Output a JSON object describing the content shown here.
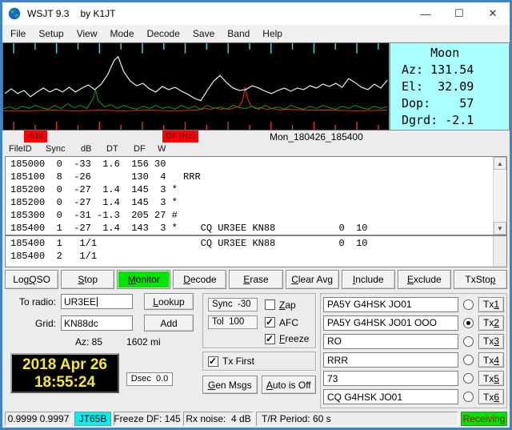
{
  "window": {
    "title_app": "WSJT 9.3",
    "title_by": "by K1JT",
    "minimize_glyph": "—",
    "maximize_glyph": "☐",
    "close_glyph": "✕"
  },
  "menu": {
    "items": [
      "File",
      "Setup",
      "View",
      "Mode",
      "Decode",
      "Save",
      "Band",
      "Help"
    ]
  },
  "moon": {
    "lines": [
      "    Moon",
      "Az: 131.54",
      "El:  32.09",
      "Dop:    57",
      "Dgrd: -2.1"
    ]
  },
  "spectrum": {
    "left_chip": "-516",
    "df_chip": "DF (Hz)",
    "file_stamp": "Mon_180426_185400",
    "ticks": {
      "count": 18,
      "start": 13,
      "spacing": 26.7,
      "top_color": "#3adada",
      "bottom_color": "#e83030",
      "top_tall": 13,
      "top_short": 8,
      "bottom_tall": 10,
      "bottom_short": 6
    },
    "cyan_trace": [
      [
        2,
        64
      ],
      [
        10,
        58
      ],
      [
        18,
        64
      ],
      [
        26,
        60
      ],
      [
        34,
        68
      ],
      [
        42,
        62
      ],
      [
        50,
        57
      ],
      [
        58,
        62
      ],
      [
        66,
        58
      ],
      [
        74,
        62
      ],
      [
        82,
        56
      ],
      [
        90,
        62
      ],
      [
        98,
        57
      ],
      [
        106,
        53
      ],
      [
        114,
        59
      ],
      [
        122,
        52
      ],
      [
        130,
        40
      ],
      [
        138,
        22
      ],
      [
        143,
        17
      ],
      [
        150,
        36
      ],
      [
        158,
        48
      ],
      [
        166,
        54
      ],
      [
        174,
        51
      ],
      [
        182,
        58
      ],
      [
        190,
        62
      ],
      [
        198,
        55
      ],
      [
        206,
        59
      ],
      [
        214,
        56
      ],
      [
        222,
        61
      ],
      [
        230,
        65
      ],
      [
        238,
        70
      ],
      [
        246,
        73
      ],
      [
        254,
        60
      ],
      [
        262,
        48
      ],
      [
        270,
        41
      ],
      [
        278,
        50
      ],
      [
        286,
        57
      ],
      [
        294,
        60
      ],
      [
        302,
        59
      ],
      [
        310,
        54
      ],
      [
        318,
        57
      ],
      [
        326,
        61
      ],
      [
        334,
        64
      ],
      [
        342,
        60
      ],
      [
        350,
        57
      ],
      [
        358,
        61
      ],
      [
        366,
        57
      ],
      [
        374,
        59
      ],
      [
        382,
        54
      ],
      [
        390,
        57
      ],
      [
        398,
        52
      ],
      [
        406,
        55
      ],
      [
        414,
        51
      ],
      [
        422,
        56
      ],
      [
        430,
        45
      ],
      [
        438,
        50
      ],
      [
        446,
        56
      ],
      [
        454,
        59
      ],
      [
        462,
        52
      ],
      [
        470,
        57
      ],
      [
        478,
        47
      ]
    ],
    "green_trace": [
      [
        0,
        83
      ],
      [
        8,
        81
      ],
      [
        16,
        84
      ],
      [
        24,
        80
      ],
      [
        32,
        83
      ],
      [
        40,
        79
      ],
      [
        48,
        82
      ],
      [
        56,
        84
      ],
      [
        64,
        79
      ],
      [
        72,
        83
      ],
      [
        80,
        77
      ],
      [
        88,
        82
      ],
      [
        96,
        79
      ],
      [
        104,
        83
      ],
      [
        112,
        70
      ],
      [
        115,
        59
      ],
      [
        118,
        73
      ],
      [
        126,
        81
      ],
      [
        134,
        78
      ],
      [
        142,
        83
      ],
      [
        150,
        79
      ],
      [
        158,
        82
      ],
      [
        166,
        84
      ],
      [
        174,
        80
      ],
      [
        182,
        83
      ],
      [
        190,
        79
      ],
      [
        198,
        83
      ],
      [
        206,
        81
      ],
      [
        214,
        84
      ],
      [
        222,
        79
      ],
      [
        230,
        83
      ],
      [
        238,
        80
      ],
      [
        246,
        84
      ],
      [
        254,
        79
      ],
      [
        262,
        83
      ],
      [
        270,
        81
      ],
      [
        278,
        84
      ],
      [
        286,
        79
      ],
      [
        294,
        82
      ],
      [
        302,
        83
      ],
      [
        310,
        80
      ],
      [
        318,
        84
      ],
      [
        326,
        79
      ],
      [
        334,
        83
      ],
      [
        342,
        81
      ],
      [
        350,
        84
      ],
      [
        358,
        79
      ],
      [
        366,
        82
      ],
      [
        374,
        84
      ],
      [
        382,
        80
      ],
      [
        390,
        83
      ],
      [
        398,
        79
      ],
      [
        406,
        82
      ],
      [
        414,
        84
      ],
      [
        422,
        80
      ],
      [
        430,
        83
      ],
      [
        438,
        79
      ],
      [
        446,
        82
      ],
      [
        454,
        84
      ],
      [
        462,
        80
      ],
      [
        470,
        83
      ],
      [
        478,
        81
      ]
    ],
    "red_trace": [
      [
        0,
        86
      ],
      [
        30,
        86
      ],
      [
        60,
        85
      ],
      [
        90,
        86
      ],
      [
        120,
        85
      ],
      [
        150,
        86
      ],
      [
        180,
        85
      ],
      [
        210,
        86
      ],
      [
        240,
        85
      ],
      [
        252,
        83
      ],
      [
        258,
        84
      ],
      [
        264,
        82
      ],
      [
        270,
        84
      ],
      [
        276,
        83
      ],
      [
        282,
        84
      ],
      [
        288,
        82
      ],
      [
        294,
        80
      ],
      [
        298,
        73
      ],
      [
        301,
        56
      ],
      [
        304,
        70
      ],
      [
        308,
        79
      ],
      [
        314,
        83
      ],
      [
        320,
        82
      ],
      [
        328,
        84
      ],
      [
        336,
        83
      ],
      [
        344,
        85
      ],
      [
        352,
        84
      ],
      [
        380,
        85
      ],
      [
        410,
        85
      ],
      [
        440,
        86
      ],
      [
        478,
        85
      ]
    ],
    "colors": {
      "cyan_trace": "#d8f6f2",
      "green_trace": "#00a300",
      "red_trace": "#ff2222"
    }
  },
  "decode": {
    "headers": [
      "FileID",
      "Sync",
      "dB",
      "DT",
      "DF",
      "W"
    ],
    "main_lines": [
      "185000  0  -33  1.6  156 30",
      "185100  8  -26       130  4   RRR",
      "185200  0  -27  1.4  145  3 *",
      "185200  0  -27  1.4  145  3 *",
      "185300  0  -31 -1.3  205 27 #",
      "185400  1  -27  1.4  143  3 *    CQ UR3EE KN88           0  10"
    ],
    "avg_lines": [
      "185400  1   1/1                  CQ UR3EE KN88           0  10",
      "185400  2   1/1"
    ],
    "scroll_up_glyph": "▲",
    "scroll_down_glyph": "▼"
  },
  "actions": {
    "log_qso": {
      "label": "Log QSO",
      "u": 4
    },
    "stop": {
      "label": "Stop",
      "u": 0
    },
    "monitor": {
      "label": "Monitor",
      "u": 0,
      "active": true
    },
    "decode": {
      "label": "Decode",
      "u": 0
    },
    "erase": {
      "label": "Erase",
      "u": 0
    },
    "clear_avg": {
      "label": "Clear Avg",
      "u": 0
    },
    "include": {
      "label": "Include",
      "u": 0
    },
    "exclude": {
      "label": "Exclude",
      "u": 0
    },
    "txstop": {
      "label": "TxStop",
      "u": 5
    }
  },
  "station": {
    "to_radio_label": "To radio:",
    "to_radio_value": "UR3EE",
    "lookup": {
      "label": "Lookup",
      "u": 0
    },
    "grid_label": "Grid:",
    "grid_value": "KN88dc",
    "add": {
      "label": "Add"
    },
    "az_text": "Az: 85",
    "distance_text": "1602 mi"
  },
  "clock": {
    "date": "2018 Apr 26",
    "time": "18:55:24",
    "dsec": "Dsec  0.0"
  },
  "params": {
    "sync_text": "Sync  -30",
    "tol_text": "Tol  100",
    "zap": {
      "label": "Zap",
      "u": 0,
      "checked": false
    },
    "afc": {
      "label": "AFC",
      "checked": true
    },
    "freeze": {
      "label": "Freeze",
      "u": 0,
      "checked": true
    },
    "tx_first": {
      "label": "Tx First",
      "checked": true
    },
    "gen_msgs": {
      "label": "Gen Msgs",
      "u": 0
    },
    "auto_btn": {
      "label": "Auto is Off",
      "u": 0
    }
  },
  "tx": {
    "rows": [
      {
        "message": "PA5Y G4HSK JO01",
        "selected": false,
        "button": {
          "label": "Tx1",
          "u": 2
        }
      },
      {
        "message": "PA5Y G4HSK JO01 OOO",
        "selected": true,
        "button": {
          "label": "Tx2",
          "u": 2
        }
      },
      {
        "message": "RO",
        "selected": false,
        "button": {
          "label": "Tx3",
          "u": 2
        }
      },
      {
        "message": "RRR",
        "selected": false,
        "button": {
          "label": "Tx4",
          "u": 2
        }
      },
      {
        "message": "73",
        "selected": false,
        "button": {
          "label": "Tx5",
          "u": 2
        }
      },
      {
        "message": "CQ G4HSK JO01",
        "selected": false,
        "button": {
          "label": "Tx6",
          "u": 2
        }
      }
    ]
  },
  "status": {
    "sync_ratio": "0.9999 0.9997",
    "mode": "JT65B",
    "freeze_df": "Freeze DF: 145",
    "rx_noise": "Rx noise:  4 dB",
    "tr_period": "T/R Period: 60 s",
    "rx_state": "Receiving"
  },
  "colors": {
    "monitor_green": "#00e400",
    "rx_state_green": "#00e400",
    "mode_cyan": "#00f0f0",
    "moon_bg": "#aaffff",
    "chip_red": "#ff0000",
    "frame_blue": "#4283c4"
  }
}
